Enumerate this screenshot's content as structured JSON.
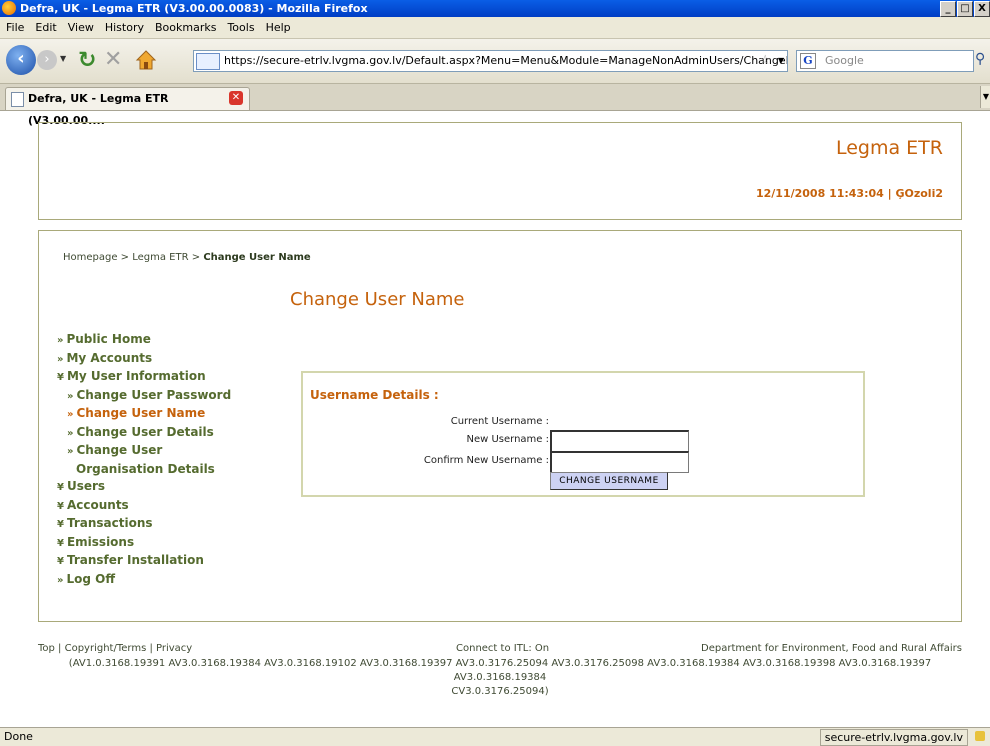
{
  "window": {
    "title": "Defra, UK - Legma ETR (V3.00.00.0083) - Mozilla Firefox",
    "controls": [
      "_",
      "□",
      "X"
    ]
  },
  "menubar": {
    "items": [
      {
        "label": "File"
      },
      {
        "label": "Edit"
      },
      {
        "label": "View"
      },
      {
        "label": "History"
      },
      {
        "label": "Bookmarks"
      },
      {
        "label": "Tools"
      },
      {
        "label": "Help"
      }
    ]
  },
  "toolbar": {
    "url": "https://secure-etrlv.lvgma.gov.lv/Default.aspx?Menu=Menu&Module=ManageNonAdminUsers/ChangeMyUserna",
    "search_placeholder": "Google",
    "search_engine": "G"
  },
  "tabs": [
    {
      "label": "Defra, UK - Legma ETR (V3.00.00....",
      "active": true
    }
  ],
  "header": {
    "brand": "Legma ETR",
    "timestamp_user": "12/11/2008 11:43:04 | ĢOzoli2"
  },
  "breadcrumb": {
    "prefix": "Homepage > Legma ETR > ",
    "current": "Change User Name"
  },
  "page_title": "Change User Name",
  "nav": [
    {
      "label": "Public Home",
      "mark": "»",
      "level": 0
    },
    {
      "label": "My Accounts",
      "mark": "»",
      "level": 0
    },
    {
      "label": "My User Information",
      "mark": "¥",
      "level": 0
    },
    {
      "label": "Change User Password",
      "mark": "»",
      "level": 1
    },
    {
      "label": "Change User Name",
      "mark": "»",
      "level": 1,
      "active": true
    },
    {
      "label": "Change User Details",
      "mark": "»",
      "level": 1
    },
    {
      "label": "Change User",
      "mark": "»",
      "level": 1
    },
    {
      "label": "Organisation Details",
      "mark": "",
      "level": 2
    },
    {
      "label": "Users",
      "mark": "¥",
      "level": 0
    },
    {
      "label": "Accounts",
      "mark": "¥",
      "level": 0
    },
    {
      "label": "Transactions",
      "mark": "¥",
      "level": 0
    },
    {
      "label": "Emissions",
      "mark": "¥",
      "level": 0
    },
    {
      "label": "Transfer Installation",
      "mark": "¥",
      "level": 0
    },
    {
      "label": "Log Off",
      "mark": "»",
      "level": 0
    }
  ],
  "form": {
    "heading": "Username Details :",
    "current_label": "Current Username :",
    "new_label": "New Username :",
    "confirm_label": "Confirm New Username :",
    "new_value": "",
    "confirm_value": "",
    "submit_label": "CHANGE USERNAME"
  },
  "footer": {
    "links": "Top | Copyright/Terms | Privacy",
    "itl_status": "Connect to ITL: On",
    "department": "Department for Environment, Food and Rural Affairs",
    "versions_line1": "(AV1.0.3168.19391 AV3.0.3168.19384 AV3.0.3168.19102 AV3.0.3168.19397 AV3.0.3176.25094 AV3.0.3176.25098 AV3.0.3168.19384 AV3.0.3168.19398 AV3.0.3168.19397 AV3.0.3168.19384",
    "versions_line2": "CV3.0.3176.25094)"
  },
  "statusbar": {
    "status": "Done",
    "host": "secure-etrlv.lvgma.gov.lv"
  },
  "colors": {
    "accent_orange": "#c5620c",
    "nav_olive": "#556b2f",
    "box_border": "#a9a97a",
    "button_bg": "#cdd2f3"
  }
}
